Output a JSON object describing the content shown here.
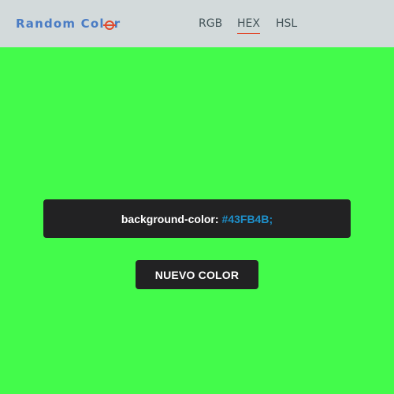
{
  "colors": {
    "background": "#43FB4B",
    "navbar_bg": "#D3DADB",
    "brand_text": "#4A7CC4",
    "accent": "#E0492D",
    "nav_text": "#45555A",
    "box_bg": "#222223",
    "value_text": "#1E8FC9"
  },
  "navbar": {
    "brand_part1": "Random Col",
    "brand_logo_icon": "crossed-o-icon",
    "brand_part2": "r",
    "links": [
      {
        "label": "RGB",
        "active": false
      },
      {
        "label": "HEX",
        "active": true
      },
      {
        "label": "HSL",
        "active": false
      }
    ]
  },
  "main": {
    "property_label": "background-color:",
    "color_value": "#43FB4B;",
    "new_color_button": "NUEVO COLOR"
  }
}
